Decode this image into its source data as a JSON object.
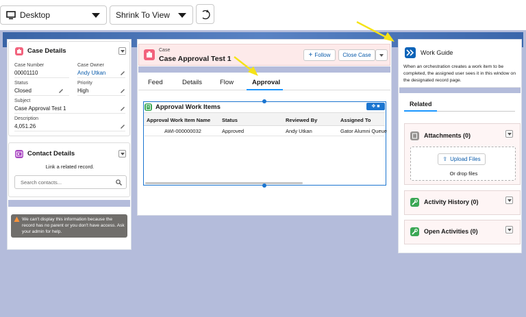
{
  "toolbar": {
    "device": "Desktop",
    "view_mode": "Shrink To View"
  },
  "case_details": {
    "title": "Case Details",
    "fields": [
      {
        "label": "Case Number",
        "value": "00001110"
      },
      {
        "label": "Case Owner",
        "value": "Andy Utkan"
      },
      {
        "label": "Status",
        "value": "Closed"
      },
      {
        "label": "Priority",
        "value": "High"
      },
      {
        "label": "Subject",
        "value": "Case Approval Test 1"
      },
      {
        "label": "Description",
        "value": "4,051.26"
      }
    ]
  },
  "contact_details": {
    "title": "Contact Details",
    "text": "Link a related record.",
    "search_placeholder": "Search contacts..."
  },
  "warning": {
    "text": "We can't display this information because the record has no parent or you don't have access. Ask your admin for help."
  },
  "record_header": {
    "object": "Case",
    "title": "Case Approval Test 1",
    "follow_label": "Follow",
    "close_case_label": "Close Case"
  },
  "tabs": [
    {
      "label": "Feed"
    },
    {
      "label": "Details"
    },
    {
      "label": "Flow"
    },
    {
      "label": "Approval",
      "active": true
    }
  ],
  "approval_table": {
    "title": "Approval Work Items",
    "headers": [
      "Approval Work Item Name",
      "Status",
      "Reviewed By",
      "Assigned To"
    ],
    "rows": [
      [
        "AWI-000000032",
        "Approved",
        "Andy Utkan",
        "Gator Alumni Queue"
      ]
    ]
  },
  "work_guide": {
    "title": "Work Guide",
    "text": "When an orchestration creates a work item to be completed, the assigned user sees it in this window on the designated record page."
  },
  "related": {
    "tab_label": "Related",
    "attachments": "Attachments (0)",
    "upload_label": "Upload Files",
    "drop_label": "Or drop files",
    "activity_history": "Activity History (0)",
    "open_activities": "Open Activities (0)"
  },
  "colors": {
    "canvas": "#b4bcdb",
    "case_icon": "#f2637d",
    "contact_icon": "#a846c2",
    "accent": "#0b5cab",
    "work_guide_icon": "#0d63b8",
    "annotation_arrow": "#f5e318"
  }
}
